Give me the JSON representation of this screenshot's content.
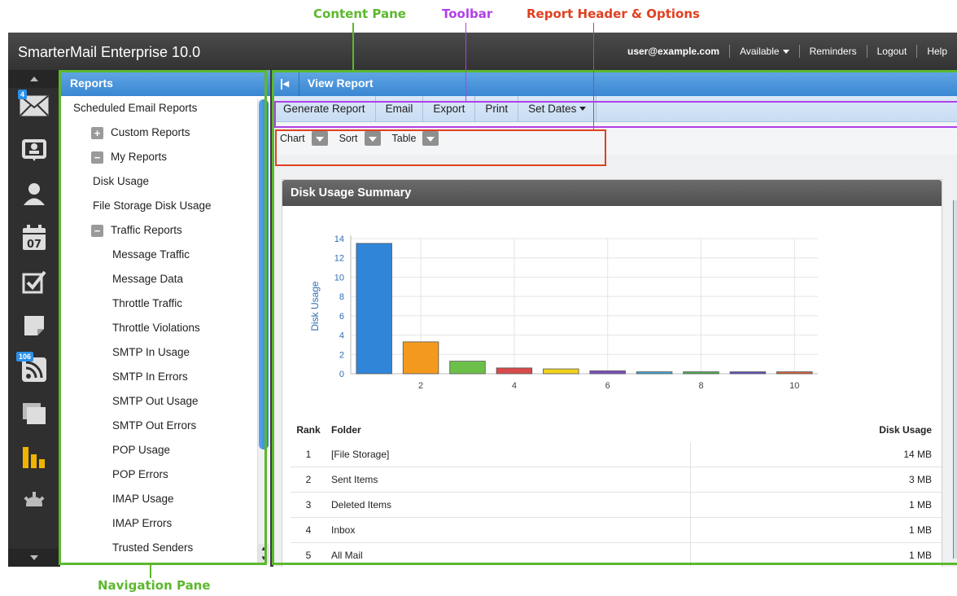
{
  "annotations": {
    "content_pane": "Content Pane",
    "toolbar": "Toolbar",
    "report_header": "Report Header & Options",
    "navigation_pane": "Navigation Pane"
  },
  "colors": {
    "green": "#5cb82e",
    "purple": "#b040e8",
    "red": "#e04020",
    "accent_blue": "#3a86d2"
  },
  "app": {
    "title": "SmarterMail Enterprise 10.0",
    "topnav": [
      "user@example.com",
      "Available",
      "Reminders",
      "Logout",
      "Help"
    ]
  },
  "rail": {
    "icons": [
      {
        "name": "mail-icon",
        "badge": "4"
      },
      {
        "name": "contacts-card-icon",
        "badge": ""
      },
      {
        "name": "user-icon",
        "badge": ""
      },
      {
        "name": "calendar-icon",
        "badge": "",
        "day": "07"
      },
      {
        "name": "tasks-checkbox-icon",
        "badge": ""
      },
      {
        "name": "notes-icon",
        "badge": ""
      },
      {
        "name": "rss-icon",
        "badge": "106"
      },
      {
        "name": "files-icon",
        "badge": ""
      },
      {
        "name": "reports-bar-chart-icon",
        "badge": ""
      },
      {
        "name": "settings-gear-icon",
        "badge": ""
      }
    ]
  },
  "nav": {
    "header": "Reports",
    "items": [
      {
        "label": "Scheduled Email Reports",
        "level": 0,
        "exp": ""
      },
      {
        "label": "Custom Reports",
        "level": 1,
        "exp": "+"
      },
      {
        "label": "My Reports",
        "level": 1,
        "exp": "−"
      },
      {
        "label": "Disk Usage",
        "level": 2,
        "exp": ""
      },
      {
        "label": "File Storage Disk Usage",
        "level": 2,
        "exp": ""
      },
      {
        "label": "Traffic Reports",
        "level": 3,
        "exp": "−"
      },
      {
        "label": "Message Traffic",
        "level": 4,
        "exp": ""
      },
      {
        "label": "Message Data",
        "level": 4,
        "exp": ""
      },
      {
        "label": "Throttle Traffic",
        "level": 4,
        "exp": ""
      },
      {
        "label": "Throttle Violations",
        "level": 4,
        "exp": ""
      },
      {
        "label": "SMTP In Usage",
        "level": 4,
        "exp": ""
      },
      {
        "label": "SMTP In Errors",
        "level": 4,
        "exp": ""
      },
      {
        "label": "SMTP Out Usage",
        "level": 4,
        "exp": ""
      },
      {
        "label": "SMTP Out Errors",
        "level": 4,
        "exp": ""
      },
      {
        "label": "POP Usage",
        "level": 4,
        "exp": ""
      },
      {
        "label": "POP Errors",
        "level": 4,
        "exp": ""
      },
      {
        "label": "IMAP Usage",
        "level": 4,
        "exp": ""
      },
      {
        "label": "IMAP Errors",
        "level": 4,
        "exp": ""
      },
      {
        "label": "Trusted Senders",
        "level": 4,
        "exp": ""
      }
    ]
  },
  "content": {
    "header": "View Report",
    "toolbar": [
      "Generate Report",
      "Email",
      "Export",
      "Print",
      "Set Dates"
    ],
    "options": [
      "Chart",
      "Sort",
      "Table"
    ],
    "card_title": "Disk Usage Summary",
    "table": {
      "headers": [
        "Rank",
        "Folder",
        "Disk Usage"
      ],
      "rows": [
        [
          "1",
          "[File Storage]",
          "14 MB"
        ],
        [
          "2",
          "Sent Items",
          "3 MB"
        ],
        [
          "3",
          "Deleted Items",
          "1 MB"
        ],
        [
          "4",
          "Inbox",
          "1 MB"
        ],
        [
          "5",
          "All Mail",
          "1 MB"
        ]
      ]
    }
  },
  "chart_data": {
    "type": "bar",
    "x": [
      1,
      2,
      3,
      4,
      5,
      6,
      7,
      8,
      9,
      10
    ],
    "values": [
      13.5,
      3.3,
      1.3,
      0.6,
      0.5,
      0.3,
      0.2,
      0.2,
      0.2,
      0.2
    ],
    "colors": [
      "#2f86d8",
      "#f39a1e",
      "#6cc04a",
      "#d94b4b",
      "#f2d21e",
      "#7b4fc0",
      "#3aa6d8",
      "#4caf50",
      "#5a4fc0",
      "#d9603a"
    ],
    "ylabel": "Disk Usage",
    "xticks": [
      2,
      4,
      6,
      8,
      10
    ],
    "yticks": [
      0,
      2,
      4,
      6,
      8,
      10,
      12,
      14
    ],
    "ylim": [
      0,
      14
    ],
    "grid": true
  }
}
